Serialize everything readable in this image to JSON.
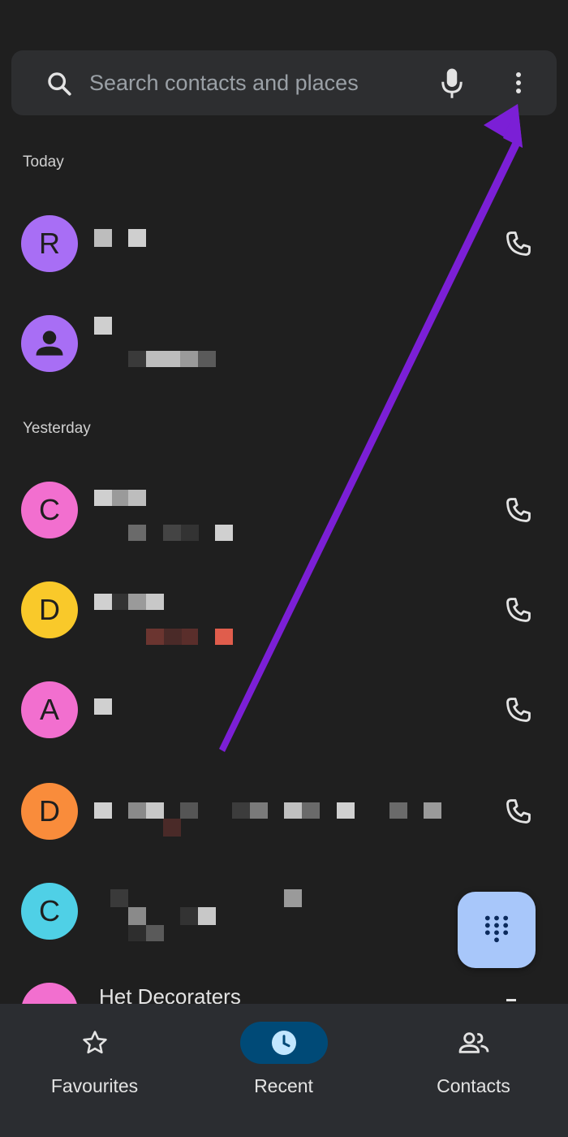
{
  "search": {
    "placeholder": "Search contacts and places",
    "icon": "search-icon",
    "mic_icon": "mic-icon",
    "more_icon": "more-vert-icon"
  },
  "sections": {
    "today": "Today",
    "yesterday": "Yesterday"
  },
  "calls": [
    {
      "avatar_letter": "R",
      "avatar_color": "#a86ef5",
      "name": "",
      "detail": ""
    },
    {
      "avatar_letter": "",
      "avatar_icon": "person-icon",
      "avatar_color": "#a86ef5",
      "name": "",
      "detail": ""
    },
    {
      "avatar_letter": "C",
      "avatar_color": "#f26fcf",
      "name": "",
      "detail": ""
    },
    {
      "avatar_letter": "D",
      "avatar_color": "#f9c92a",
      "name": "",
      "detail": ""
    },
    {
      "avatar_letter": "A",
      "avatar_color": "#f26fcf",
      "name": "",
      "detail": ""
    },
    {
      "avatar_letter": "D",
      "avatar_color": "#f98c3b",
      "name": "",
      "detail": ""
    },
    {
      "avatar_letter": "C",
      "avatar_color": "#4fd0e6",
      "name": "",
      "detail": ""
    },
    {
      "avatar_letter": "",
      "avatar_color": "#f26fcf",
      "name": "Het Decoraters",
      "detail": ""
    }
  ],
  "fab": {
    "icon": "dialpad-icon"
  },
  "nav": {
    "favourites": "Favourites",
    "recent": "Recent",
    "contacts": "Contacts"
  },
  "colors": {
    "background": "#1f1f1f",
    "search_bg": "#2d2e30",
    "fab_bg": "#a8c7fa",
    "nav_active": "#004a77",
    "annotation_arrow": "#7b1fd6"
  }
}
